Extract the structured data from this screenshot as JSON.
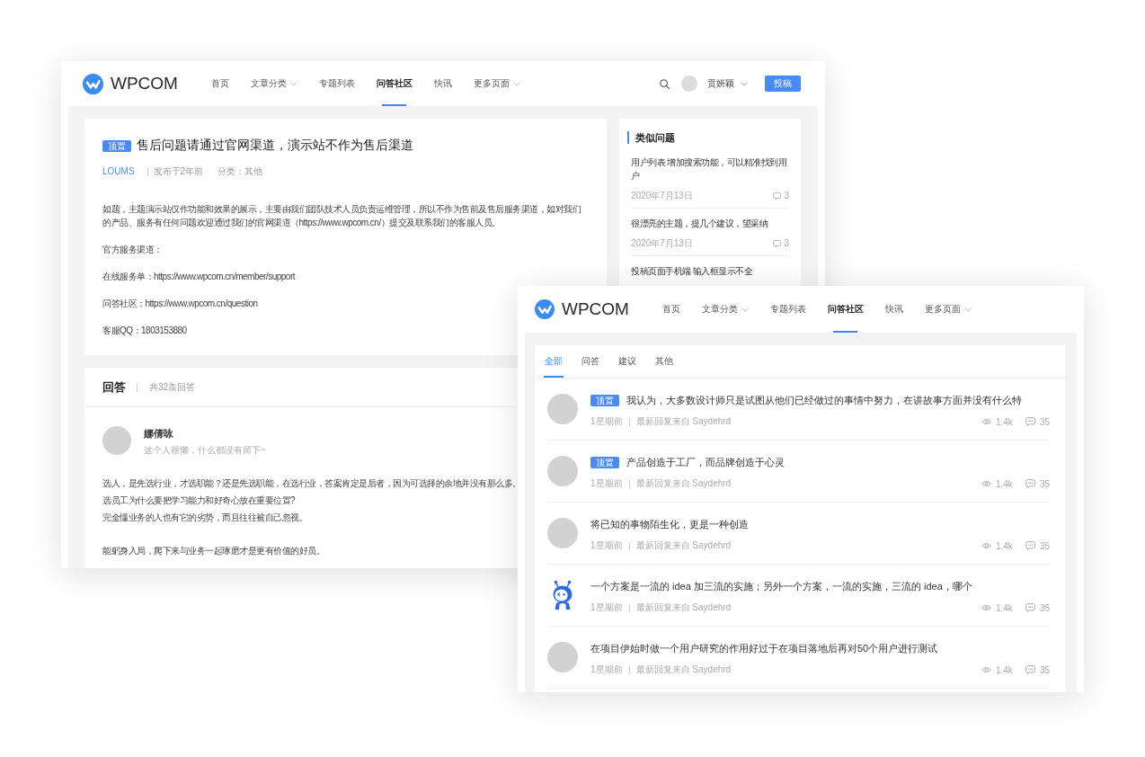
{
  "question_window": {
    "header": {
      "logo": "WPCOM",
      "nav": [
        {
          "label": "首页",
          "dropdown": false,
          "selected": false
        },
        {
          "label": "文章分类",
          "dropdown": true,
          "selected": false
        },
        {
          "label": "专题列表",
          "dropdown": false,
          "selected": false
        },
        {
          "label": "问答社区",
          "dropdown": false,
          "selected": true
        },
        {
          "label": "快讯",
          "dropdown": false,
          "selected": false
        },
        {
          "label": "更多页面",
          "dropdown": true,
          "selected": false
        }
      ],
      "user": {
        "name": "贲妍颖"
      },
      "post_button": "投稿"
    },
    "question": {
      "badge": "顶置",
      "title": "售后问题请通过官网渠道，演示站不作为售后渠道",
      "author": "LOUMS",
      "published": "发布于2年前",
      "category": "分类：其他",
      "paragraphs": [
        "如题，主题演示站仅作功能和效果的展示，主要由我们团队技术人员负责运维管理，所以不作为售前及售后服务渠道，如对我们的产品、服务有任何问题欢迎通过我们的官网渠道（https://www.wpcom.cn/）提交及联系我们的客服人员。",
        "官方服务渠道：",
        "在线服务单：https://www.wpcom.cn/member/support",
        "问答社区：https://www.wpcom.cn/question",
        "客服QQ：1803153880"
      ]
    },
    "answers": {
      "title": "回答",
      "count": "共32条回答",
      "items": [
        {
          "name": "娜倩咏",
          "bio": "这个人很懒，什么都没有留下~",
          "paragraphs": [
            [
              "选人，是先选行业，才选职能？还是先选职能，在选行业，答案肯定是后者，因为可选择的余地并没有那么多。",
              "选员工为什么要把学习能力和好奇心放在重要位置?",
              "完全懂业务的人也有它的劣势，而且往往被自己忽视。"
            ],
            [
              "能躬身入局，爬下来与业务一起琢磨才是更有价值的好员。"
            ]
          ]
        }
      ]
    },
    "similar": {
      "title": "类似问题",
      "items": [
        {
          "title": "用户列表 增加搜索功能，可以精准找到用户",
          "date": "2020年7月13日",
          "comments": "3"
        },
        {
          "title": "很漂亮的主题，提几个建议，望采纳",
          "date": "2020年7月13日",
          "comments": "3"
        },
        {
          "title": "投稿页面手机端 输入框显示不全"
        }
      ]
    }
  },
  "list_window": {
    "header": {
      "logo": "WPCOM",
      "nav": [
        {
          "label": "首页",
          "dropdown": false,
          "selected": false
        },
        {
          "label": "文章分类",
          "dropdown": true,
          "selected": false
        },
        {
          "label": "专题列表",
          "dropdown": false,
          "selected": false
        },
        {
          "label": "问答社区",
          "dropdown": false,
          "selected": true
        },
        {
          "label": "快讯",
          "dropdown": false,
          "selected": false
        },
        {
          "label": "更多页面",
          "dropdown": true,
          "selected": false
        }
      ]
    },
    "tabs": [
      {
        "label": "全部",
        "selected": true
      },
      {
        "label": "问答",
        "selected": false
      },
      {
        "label": "建议",
        "selected": false
      },
      {
        "label": "其他",
        "selected": false
      }
    ],
    "questions": [
      {
        "avatar": {
          "kind": "photo"
        },
        "badge": "顶置",
        "title": "我认为，大多数设计师只是试图从他们已经做过的事情中努力，在讲故事方面并没有什么特",
        "time": "1星期前",
        "last_reply": "最新回复来自 Saydehrd",
        "views": "1.4k",
        "replies": "35"
      },
      {
        "avatar": {
          "kind": "photo"
        },
        "badge": "顶置",
        "title": "产品创造于工厂，而品牌创造于心灵",
        "time": "1星期前",
        "last_reply": "最新回复来自 Saydehrd",
        "views": "1.4k",
        "replies": "35"
      },
      {
        "avatar": {
          "kind": "photo"
        },
        "title": "将已知的事物陌生化，更是一种创造",
        "time": "1星期前",
        "last_reply": "最新回复来自 Saydehrd",
        "views": "1.4k",
        "replies": "35"
      },
      {
        "avatar": {
          "kind": "illustration"
        },
        "title": "一个方案是一流的 idea 加三流的实施；另外一个方案，一流的实施，三流的 idea，哪个",
        "time": "1星期前",
        "last_reply": "最新回复来自 Saydehrd",
        "views": "1.4k",
        "replies": "35"
      },
      {
        "avatar": {
          "kind": "photo"
        },
        "title": "在项目伊始时做一个用户研究的作用好过于在项目落地后再对50个用户进行测试",
        "time": "1星期前",
        "last_reply": "最新回复来自 Saydehrd",
        "views": "1.4k",
        "replies": "35"
      }
    ]
  }
}
